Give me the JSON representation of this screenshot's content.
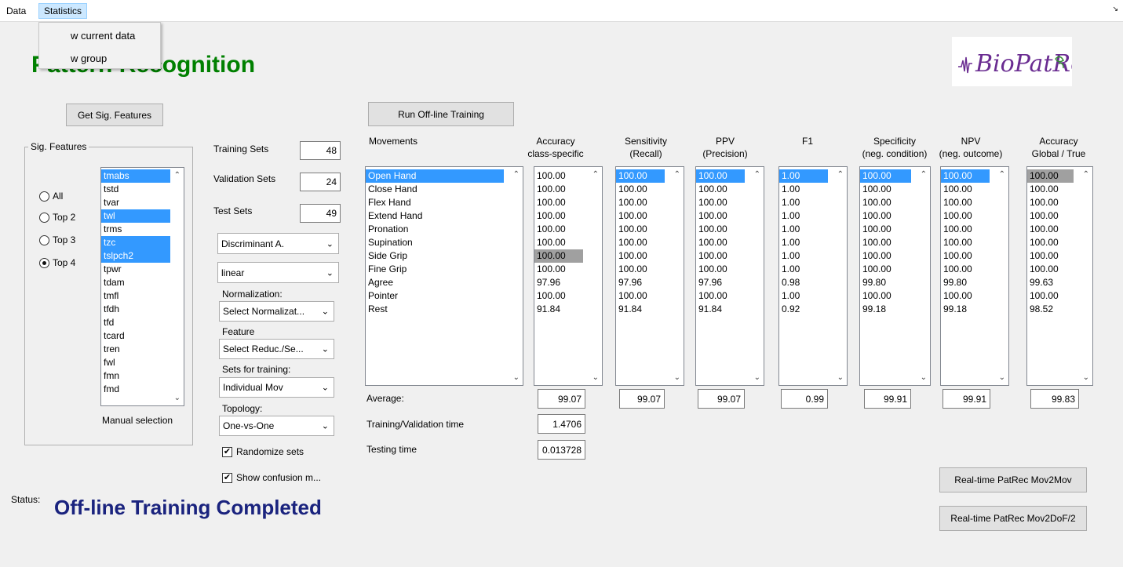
{
  "menu": {
    "data": "Data",
    "statistics": "Statistics",
    "items": [
      "w current data",
      "w group"
    ]
  },
  "title": "Pattern Recognition",
  "logo_text": "BioPatRec",
  "buttons": {
    "get_sig_features": "Get Sig. Features",
    "run_offline": "Run Off-line Training",
    "realtime_mov2mov": "Real-time PatRec Mov2Mov",
    "realtime_mov2dof": "Real-time PatRec Mov2DoF/2"
  },
  "sig_features": {
    "label": "Sig. Features",
    "radios": [
      {
        "label": "All",
        "checked": false
      },
      {
        "label": "Top 2",
        "checked": false
      },
      {
        "label": "Top 3",
        "checked": false
      },
      {
        "label": "Top 4",
        "checked": true
      }
    ],
    "list": [
      {
        "name": "tmabs",
        "selected": true
      },
      {
        "name": "tstd",
        "selected": false
      },
      {
        "name": "tvar",
        "selected": false
      },
      {
        "name": "twl",
        "selected": true
      },
      {
        "name": "trms",
        "selected": false
      },
      {
        "name": "tzc",
        "selected": true
      },
      {
        "name": "tslpch2",
        "selected": true
      },
      {
        "name": "tpwr",
        "selected": false
      },
      {
        "name": "tdam",
        "selected": false
      },
      {
        "name": "tmfl",
        "selected": false
      },
      {
        "name": "tfdh",
        "selected": false
      },
      {
        "name": "tfd",
        "selected": false
      },
      {
        "name": "tcard",
        "selected": false
      },
      {
        "name": "tren",
        "selected": false
      },
      {
        "name": "fwl",
        "selected": false
      },
      {
        "name": "fmn",
        "selected": false
      },
      {
        "name": "fmd",
        "selected": false
      }
    ],
    "manual_label": "Manual selection"
  },
  "sets": {
    "training_label": "Training Sets",
    "training_value": "48",
    "validation_label": "Validation Sets",
    "validation_value": "24",
    "test_label": "Test Sets",
    "test_value": "49"
  },
  "config": {
    "algorithm": "Discriminant A.",
    "algo_type": "linear",
    "normalization_label": "Normalization:",
    "normalization_value": "Select Normalizat...",
    "feature_label": "Feature",
    "feature_value": "Select Reduc./Se...",
    "sets_training_label": "Sets for training:",
    "sets_training_value": "Individual Mov",
    "topology_label": "Topology:",
    "topology_value": "One-vs-One",
    "randomize_label": "Randomize sets",
    "randomize_checked": true,
    "confusion_label": "Show confusion m...",
    "confusion_checked": true
  },
  "movements_label": "Movements",
  "movements": [
    "Open Hand",
    "Close Hand",
    "Flex Hand",
    "Extend Hand",
    "Pronation",
    "Supination",
    "Side Grip",
    "Fine Grip",
    "Agree",
    "Pointer",
    "Rest"
  ],
  "columns": [
    {
      "h1": "Accuracy",
      "h2": "class-specific",
      "values": [
        "100.00",
        "100.00",
        "100.00",
        "100.00",
        "100.00",
        "100.00",
        "100.00",
        "100.00",
        "97.96",
        "100.00",
        "91.84"
      ],
      "average": "99.07"
    },
    {
      "h1": "Sensitivity",
      "h2": "(Recall)",
      "values": [
        "100.00",
        "100.00",
        "100.00",
        "100.00",
        "100.00",
        "100.00",
        "100.00",
        "100.00",
        "97.96",
        "100.00",
        "91.84"
      ],
      "average": "99.07"
    },
    {
      "h1": "PPV",
      "h2": "(Precision)",
      "values": [
        "100.00",
        "100.00",
        "100.00",
        "100.00",
        "100.00",
        "100.00",
        "100.00",
        "100.00",
        "97.96",
        "100.00",
        "91.84"
      ],
      "average": "99.07"
    },
    {
      "h1": "F1",
      "h2": "",
      "values": [
        "1.00",
        "1.00",
        "1.00",
        "1.00",
        "1.00",
        "1.00",
        "1.00",
        "1.00",
        "0.98",
        "1.00",
        "0.92"
      ],
      "average": "0.99"
    },
    {
      "h1": "Specificity",
      "h2": "(neg. condition)",
      "values": [
        "100.00",
        "100.00",
        "100.00",
        "100.00",
        "100.00",
        "100.00",
        "100.00",
        "100.00",
        "99.80",
        "100.00",
        "99.18"
      ],
      "average": "99.91"
    },
    {
      "h1": "NPV",
      "h2": "(neg. outcome)",
      "values": [
        "100.00",
        "100.00",
        "100.00",
        "100.00",
        "100.00",
        "100.00",
        "100.00",
        "100.00",
        "99.80",
        "100.00",
        "99.18"
      ],
      "average": "99.91"
    },
    {
      "h1": "Accuracy",
      "h2": "Global / True",
      "values": [
        "100.00",
        "100.00",
        "100.00",
        "100.00",
        "100.00",
        "100.00",
        "100.00",
        "100.00",
        "99.63",
        "100.00",
        "98.52"
      ],
      "average": "99.83"
    }
  ],
  "average_label": "Average:",
  "timing": {
    "train_label": "Training/Validation time",
    "train_value": "1.4706",
    "test_label": "Testing time",
    "test_value": "0.013728"
  },
  "status": {
    "label": "Status:",
    "text": "Off-line Training Completed"
  }
}
